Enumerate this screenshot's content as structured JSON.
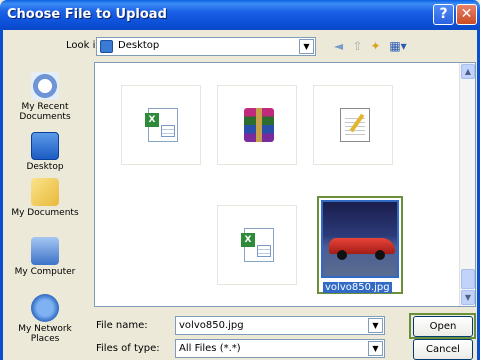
{
  "window": {
    "title": "Choose File to Upload",
    "help_glyph": "?",
    "close_glyph": "✕"
  },
  "toolbar": {
    "look_in_label": "Look in:",
    "look_in_value": "Desktop",
    "back_glyph": "◄",
    "up_glyph": "⇧",
    "new_folder_glyph": "✦",
    "views_glyph": "▦▾"
  },
  "places": [
    {
      "label": "My Recent Documents",
      "icon": "recent-documents-icon"
    },
    {
      "label": "Desktop",
      "icon": "desktop-icon"
    },
    {
      "label": "My Documents",
      "icon": "my-documents-icon"
    },
    {
      "label": "My Computer",
      "icon": "my-computer-icon"
    },
    {
      "label": "My Network Places",
      "icon": "network-places-icon"
    }
  ],
  "files": [
    {
      "icon": "excel-file-icon"
    },
    {
      "icon": "winrar-archive-icon"
    },
    {
      "icon": "notepad-text-file-icon"
    },
    {
      "icon": "excel-file-icon"
    },
    {
      "name": "volvo850.jpg",
      "icon": "jpeg-image-thumbnail",
      "selected": true
    }
  ],
  "form": {
    "file_name_label": "File name:",
    "file_name_value": "volvo850.jpg",
    "file_type_label": "Files of type:",
    "file_type_value": "All Files (*.*)",
    "open_label": "Open",
    "cancel_label": "Cancel"
  },
  "colors": {
    "titlebar": "#0a5fe0",
    "selection": "#316ac5",
    "highlight_box": "#6b8e39"
  }
}
